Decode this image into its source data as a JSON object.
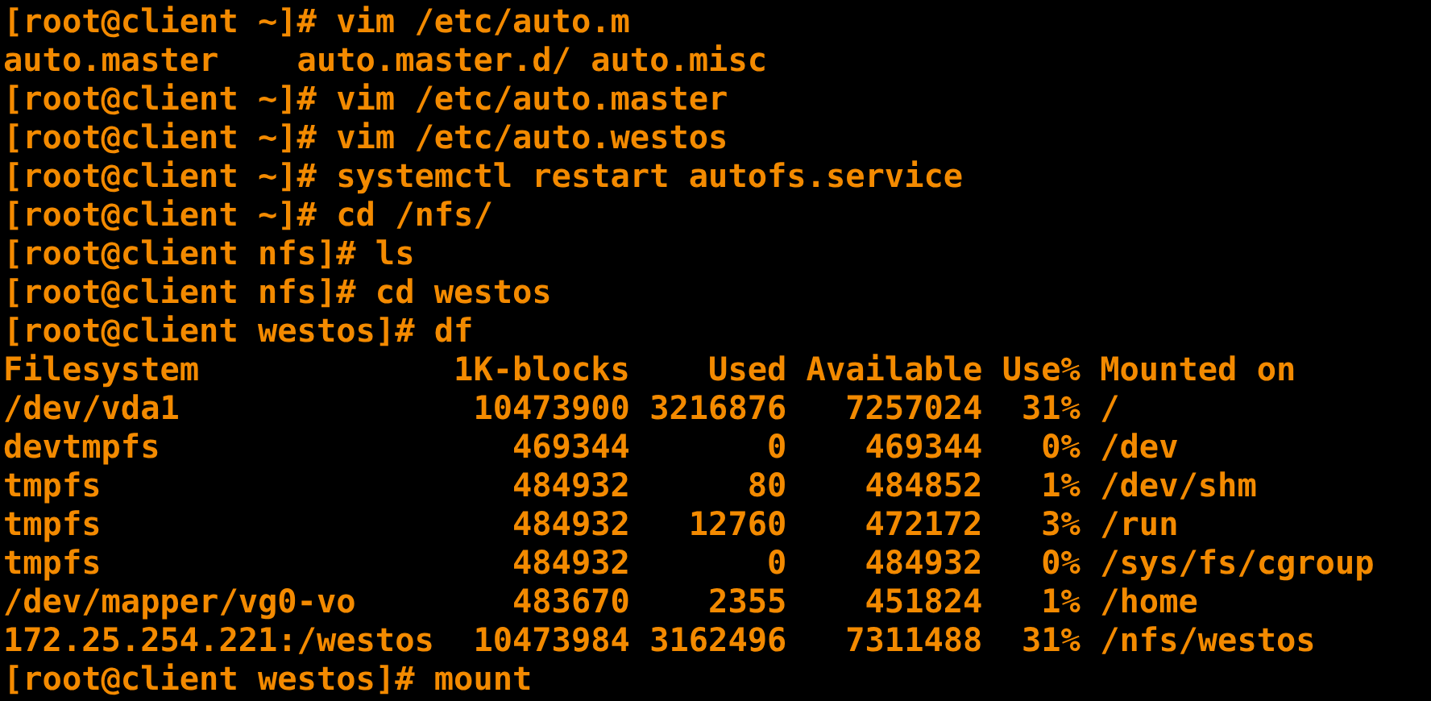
{
  "terminal": {
    "lines": [
      "[root@client ~]# vim /etc/auto.m",
      "auto.master    auto.master.d/ auto.misc",
      "[root@client ~]# vim /etc/auto.master",
      "[root@client ~]# vim /etc/auto.westos",
      "[root@client ~]# systemctl restart autofs.service",
      "[root@client ~]# cd /nfs/",
      "[root@client nfs]# ls",
      "[root@client nfs]# cd westos",
      "[root@client westos]# df",
      "Filesystem             1K-blocks    Used Available Use% Mounted on",
      "/dev/vda1               10473900 3216876   7257024  31% /",
      "devtmpfs                  469344       0    469344   0% /dev",
      "tmpfs                     484932      80    484852   1% /dev/shm",
      "tmpfs                     484932   12760    472172   3% /run",
      "tmpfs                     484932       0    484932   0% /sys/fs/cgroup",
      "/dev/mapper/vg0-vo        483670    2355    451824   1% /home",
      "172.25.254.221:/westos  10473984 3162496   7311488  31% /nfs/westos",
      "[root@client westos]# mount"
    ]
  }
}
